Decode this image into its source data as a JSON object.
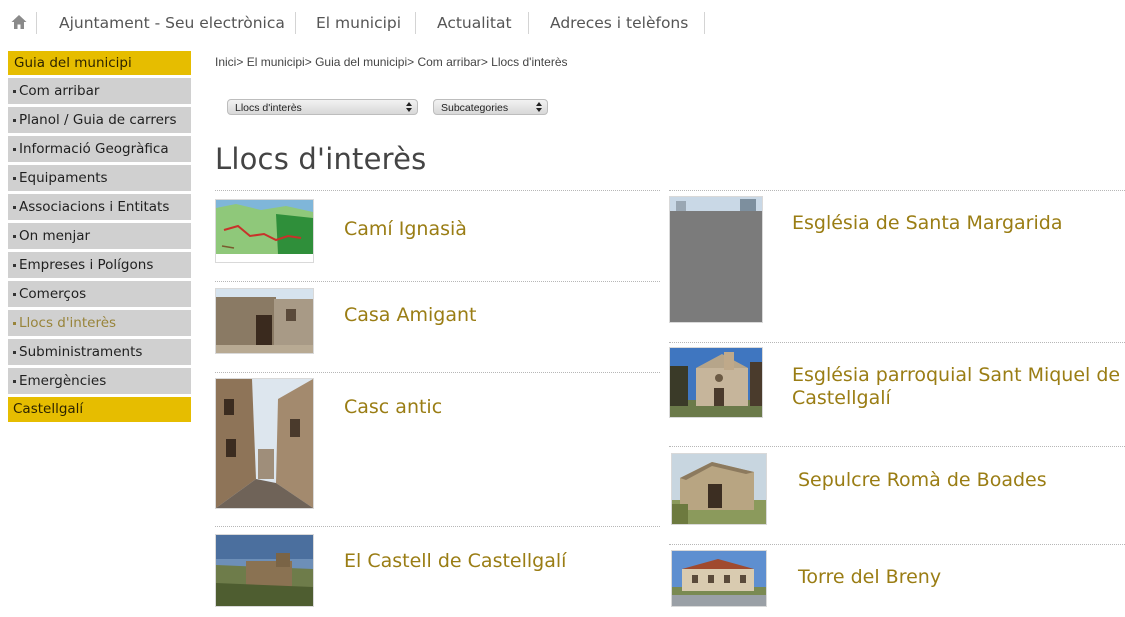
{
  "topnav": {
    "home_icon": "home-icon",
    "links": [
      "Ajuntament - Seu electrònica",
      "El municipi",
      "Actualitat",
      "Adreces i telèfons"
    ]
  },
  "sidebar": {
    "header": "Guia del municipi",
    "items": [
      {
        "label": "Com arribar"
      },
      {
        "label": "Planol / Guia de carrers"
      },
      {
        "label": "Informació Geogràfica"
      },
      {
        "label": "Equipaments"
      },
      {
        "label": "Associacions i Entitats"
      },
      {
        "label": "On menjar"
      },
      {
        "label": "Empreses i Polígons"
      },
      {
        "label": "Comerços"
      },
      {
        "label": "Llocs d'interès",
        "active": true
      },
      {
        "label": "Subministraments"
      },
      {
        "label": "Emergències"
      }
    ],
    "footer": "Castellgalí"
  },
  "breadcrumb": {
    "items": [
      "Inici",
      "El municipi",
      "Guia del municipi",
      "Com arribar"
    ],
    "current": "Llocs d'interès",
    "separator": "> "
  },
  "filters": {
    "category": "Llocs d'interès",
    "subcategory": "Subcategories"
  },
  "page": {
    "title": "Llocs d'interès"
  },
  "places": {
    "left": [
      {
        "title": "Camí Ignasià"
      },
      {
        "title": "Casa Amigant"
      },
      {
        "title": "Casc antic"
      },
      {
        "title": "El Castell de Castellgalí"
      }
    ],
    "right": [
      {
        "title": "Església de Santa Margarida"
      },
      {
        "title": "Església parroquial Sant Miquel de Castellgalí"
      },
      {
        "title": "Sepulcre Romà de Boades"
      },
      {
        "title": "Torre del Breny"
      }
    ]
  },
  "colors": {
    "accent_yellow": "#e6bd00",
    "link_gold": "#9a7d14",
    "sidebar_gray": "#d0d0d0"
  }
}
